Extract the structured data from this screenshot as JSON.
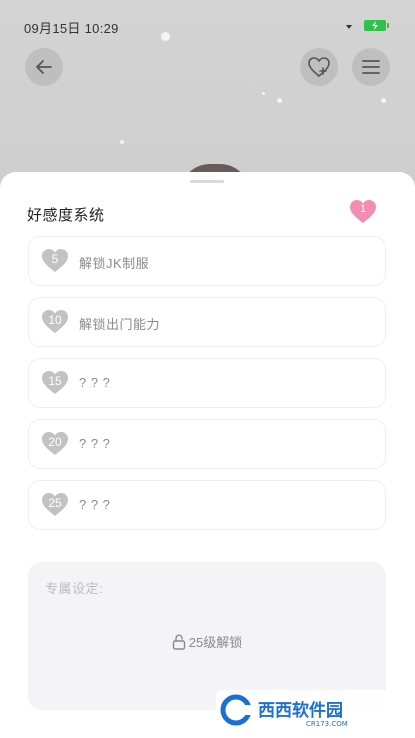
{
  "status_bar": {
    "time": "09月15日  10:29"
  },
  "toolbar": {
    "back_icon": "arrow-left-icon",
    "favorite_icon": "heart-icon",
    "menu_icon": "menu-icon"
  },
  "affection_sheet": {
    "title": "好感度系统",
    "current_level": "1",
    "accent_color": "#f28fb0",
    "locked_color": "#c2c2c2",
    "rewards": [
      {
        "level": "5",
        "label": "解锁JK制服"
      },
      {
        "level": "10",
        "label": "解锁出门能力"
      },
      {
        "level": "15",
        "label": "? ? ?"
      },
      {
        "level": "20",
        "label": "? ? ?"
      },
      {
        "level": "25",
        "label": "? ? ?"
      }
    ],
    "exclusive": {
      "label": "专属设定:",
      "lock_icon": "lock-icon",
      "unlock_text": "25级解锁"
    }
  },
  "watermark": {
    "brand": "西西软件园",
    "site": "CR173.COM"
  }
}
